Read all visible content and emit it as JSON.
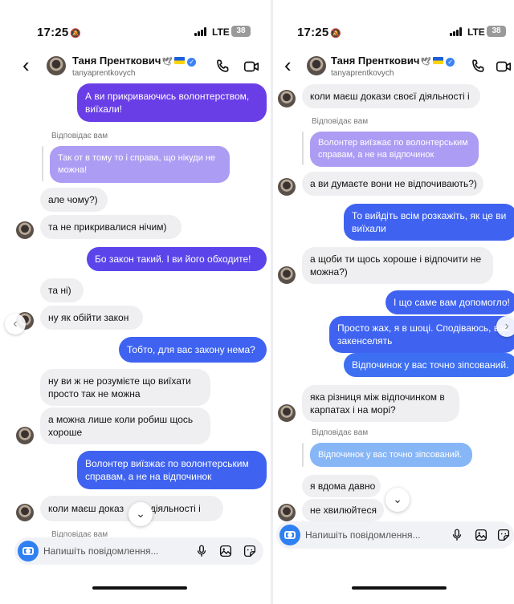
{
  "screens": [
    {
      "status": {
        "time": "17:25",
        "network": "LTE",
        "battery": "38"
      },
      "header": {
        "name": "Таня Пренткович",
        "username": "tanyaprentkovych"
      },
      "messages": [
        {
          "from": "me",
          "text": "А ви прикриваючись волонтерством,\nвиїхали!"
        },
        {
          "reply_label": "Відповідає вам",
          "quote": "Так от в тому то і справа, що нікуди не\nможна!"
        },
        {
          "from": "them",
          "text": "але чому?)"
        },
        {
          "from": "them",
          "text": "та не прикривалися нічим)"
        },
        {
          "from": "me",
          "text": "Бо закон такий. І ви його обходите!"
        },
        {
          "from": "them",
          "text": "та ні)"
        },
        {
          "from": "them",
          "text": "ну як обійти закон"
        },
        {
          "from": "me",
          "text": "Тобто, для вас закону нема?"
        },
        {
          "from": "them",
          "text": "ну ви ж не розумієте що виїхати\nпросто так не можна"
        },
        {
          "from": "them",
          "text": "а можна лише коли робиш щось\nхороше"
        },
        {
          "from": "me",
          "text": "Волонтер виїзжає по волонтерським\nсправам, а не на відпочинок"
        },
        {
          "from": "them",
          "text": "коли маєш доказ    оєї діяльності і"
        },
        {
          "reply_label": "Відповідає вам"
        }
      ],
      "composer": {
        "placeholder": "Напишіть повідомлення..."
      }
    },
    {
      "status": {
        "time": "17:25",
        "network": "LTE",
        "battery": "38"
      },
      "header": {
        "name": "Таня Пренткович",
        "username": "tanyaprentkovych"
      },
      "messages": [
        {
          "from": "them",
          "text": "коли маєш докази своєї діяльності і"
        },
        {
          "reply_label": "Відповідає вам",
          "quote": "Волонтер виїзжає по волонтерським\nсправам, а не на відпочинок"
        },
        {
          "from": "them",
          "text": "а ви думаєте вони не відпочивають?)"
        },
        {
          "from": "me",
          "text": "То вийдіть всім розкажіть, як це ви\nвиїхали"
        },
        {
          "from": "them",
          "text": "а щоби ти щось хороше і відпочити не\nможна?)"
        },
        {
          "from": "me",
          "text": "І що саме вам допомогло!"
        },
        {
          "from": "me",
          "text": "Просто жах, я в шоці. Сподіваюсь, вас\nзакенселять"
        },
        {
          "from": "me",
          "text": "Відпочинок у вас точно зіпсований."
        },
        {
          "from": "them",
          "text": "яка різниця між відпочинком в\nкарпатах і на морі?"
        },
        {
          "reply_label": "Відповідає вам",
          "quote": "Відпочинок у вас точно зіпсований."
        },
        {
          "from": "them",
          "text": "я вдома давно"
        },
        {
          "from": "them",
          "text": "не хвилюйтеся"
        }
      ],
      "composer": {
        "placeholder": "Напишіть повідомлення..."
      }
    }
  ],
  "colors": {
    "purple": "#6a3ee7",
    "violet": "#5b45ea",
    "blue": "#3f63f0",
    "incoming": "#efeff1",
    "reply_quote_lilac": "#ad9cf3",
    "reply_quote_blue": "#87b6f6",
    "camera_button": "#2f80f2"
  },
  "icons": [
    "back-arrow-icon",
    "verified-icon",
    "dove-icon",
    "phone-icon",
    "video-icon",
    "camera-icon",
    "microphone-icon",
    "gallery-icon",
    "sticker-icon",
    "chevron-down-icon",
    "chevron-right-icon",
    "chevron-left-icon"
  ]
}
